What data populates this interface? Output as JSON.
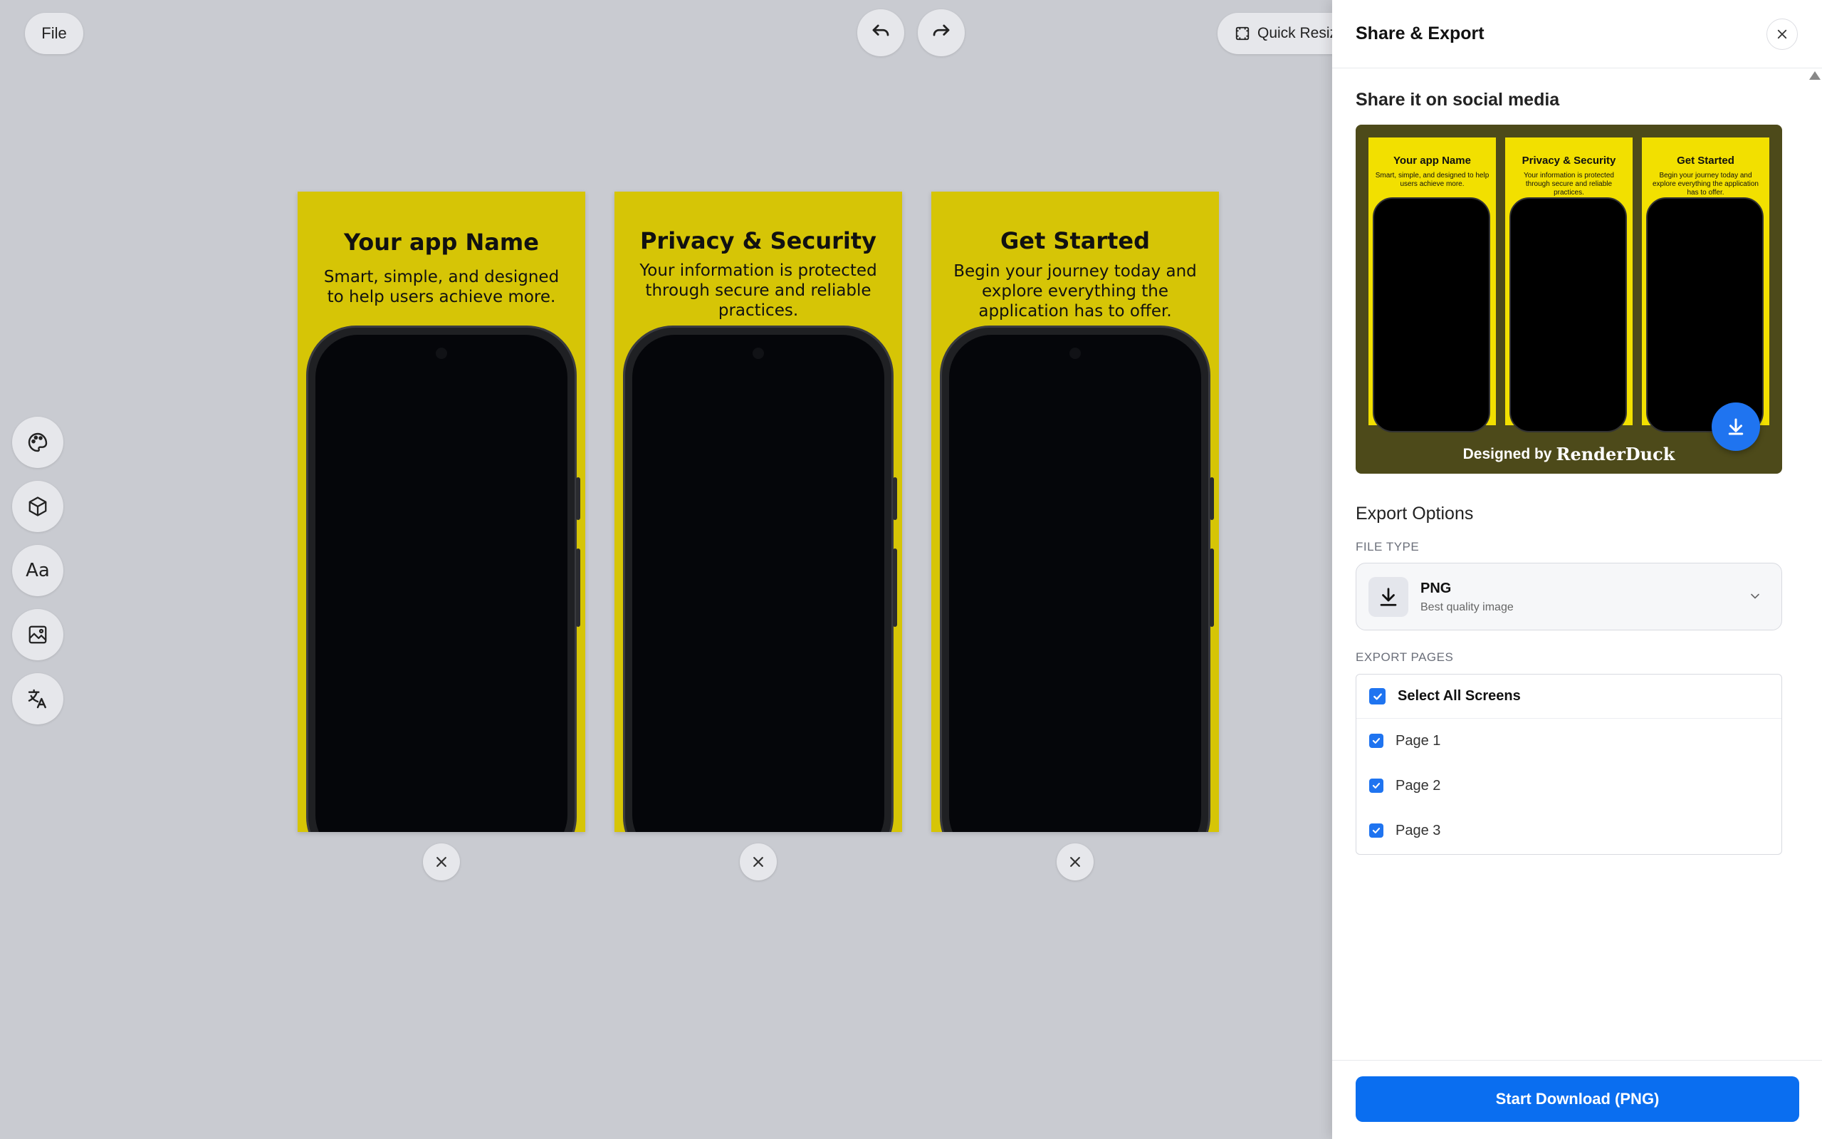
{
  "toolbar": {
    "file_label": "File",
    "undo_icon": "undo-icon",
    "redo_icon": "redo-icon",
    "quick_resize_label": "Quick Resiz"
  },
  "sidebar_tools": [
    "palette-icon",
    "cube-icon",
    "text-style-icon",
    "image-icon",
    "translate-icon"
  ],
  "tool_labels": {
    "text_style": "Aa"
  },
  "screens": [
    {
      "title": "Your app Name",
      "subtitle": "Smart, simple, and designed to help users achieve more."
    },
    {
      "title": "Privacy & Security",
      "subtitle": "Your information is protected through secure and reliable practices."
    },
    {
      "title": "Get Started",
      "subtitle": "Begin your journey today and explore everything the application has to offer."
    }
  ],
  "colors": {
    "canvas_bg": "#c9cbd1",
    "screen_bg": "#d6c506",
    "accent": "#0a6ef0"
  },
  "panel": {
    "title": "Share & Export",
    "social_title": "Share it on social media",
    "preview": {
      "footer_prefix": "Designed by",
      "footer_brand": "RenderDuck"
    },
    "export_title": "Export Options",
    "file_type_label": "FILE TYPE",
    "file_type": {
      "name": "PNG",
      "description": "Best quality image"
    },
    "export_pages_label": "EXPORT PAGES",
    "pages": [
      {
        "label": "Select All Screens",
        "checked": true
      },
      {
        "label": "Page 1",
        "checked": true
      },
      {
        "label": "Page 2",
        "checked": true
      },
      {
        "label": "Page 3",
        "checked": true
      }
    ],
    "download_label": "Start Download (PNG)"
  }
}
